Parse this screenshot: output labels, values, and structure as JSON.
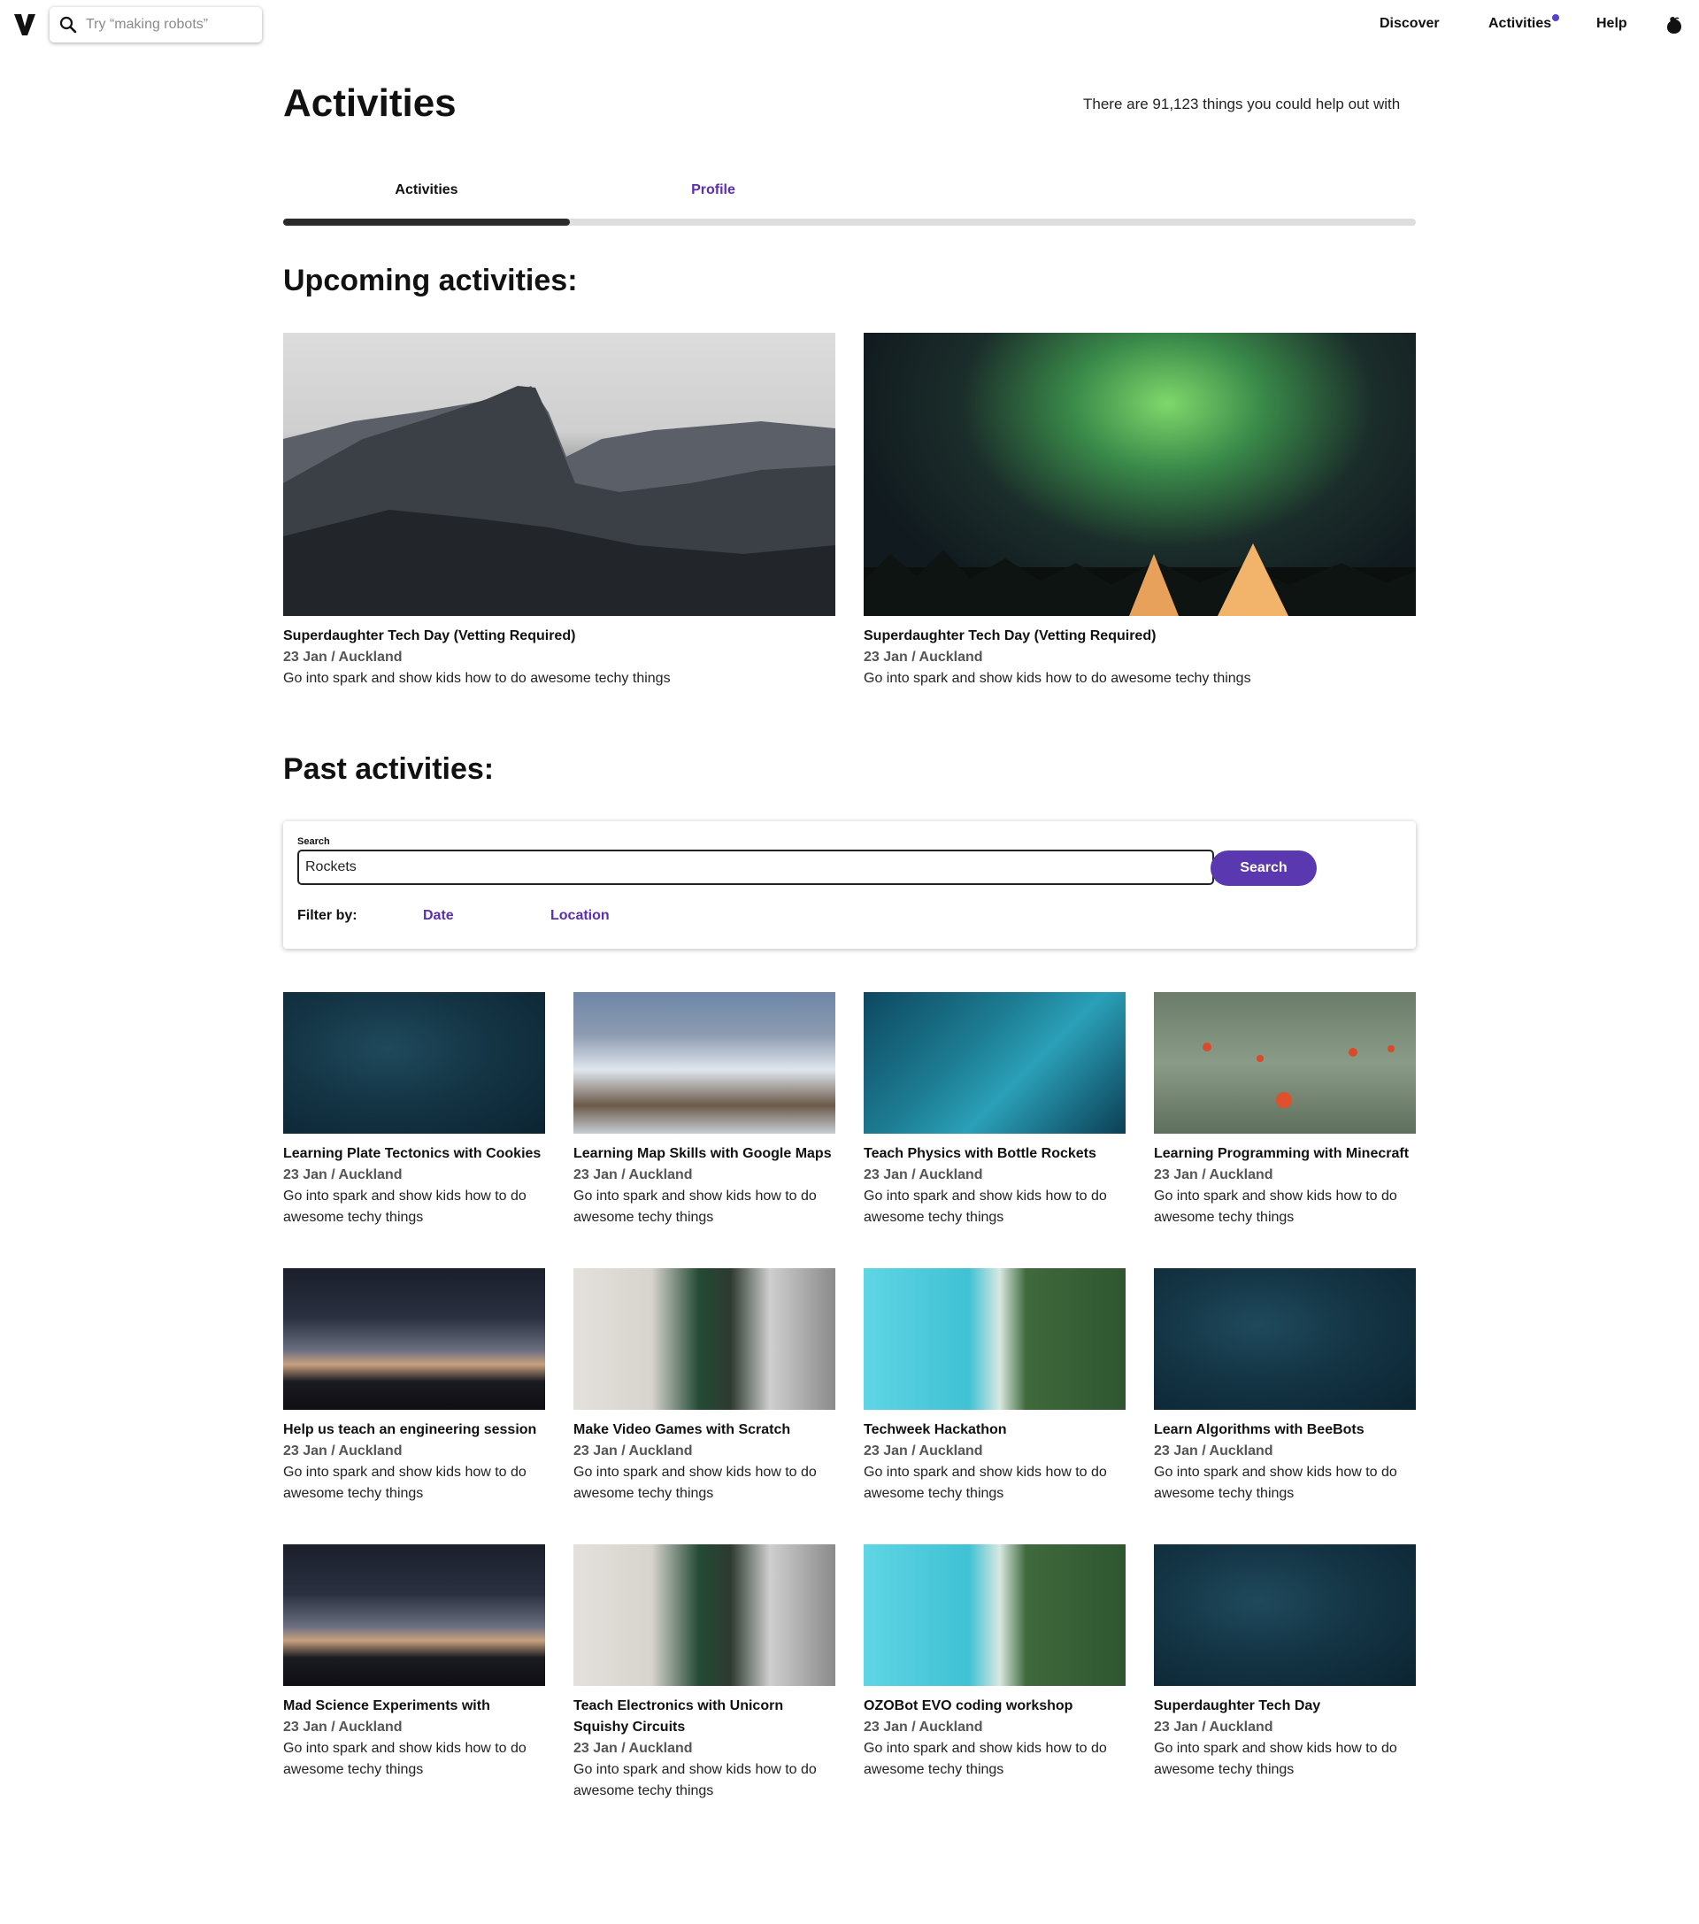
{
  "search": {
    "placeholder": "Try “making robots”"
  },
  "nav": {
    "items": [
      {
        "label": "Discover"
      },
      {
        "label": "Activities"
      },
      {
        "label": "Help"
      }
    ]
  },
  "header": {
    "title": "Activities",
    "count_text": "There are 91,123 things you could help out with"
  },
  "tabs": [
    {
      "label": "Activities",
      "active": true
    },
    {
      "label": "Profile",
      "active": false
    }
  ],
  "upcoming": {
    "heading": "Upcoming activities:",
    "items": [
      {
        "title": "Superdaughter Tech Day (Vetting Required)",
        "meta": "23 Jan / Auckland",
        "desc": "Go into spark and show kids how to do awesome techy things"
      },
      {
        "title": "Superdaughter Tech Day (Vetting Required)",
        "meta": "23 Jan / Auckland",
        "desc": "Go into spark and show kids how to do awesome techy things"
      }
    ]
  },
  "past": {
    "heading": "Past activities:",
    "search_label": "Search",
    "search_value": "Rockets",
    "search_button": "Search",
    "filter_label": "Filter by:",
    "filters": [
      "Date",
      "Location"
    ],
    "items": [
      {
        "title": "Learning Plate Tectonics with Cookies",
        "meta": "23 Jan / Auckland",
        "desc": "Go into spark and show kids how to do awesome techy things"
      },
      {
        "title": "Learning Map Skills with Google Maps",
        "meta": "23 Jan / Auckland",
        "desc": "Go into spark and show kids how to do awesome techy things"
      },
      {
        "title": "Teach Physics with Bottle Rockets",
        "meta": "23 Jan / Auckland",
        "desc": "Go into spark and show kids how to do awesome techy things"
      },
      {
        "title": "Learning Programming with Minecraft",
        "meta": "23 Jan / Auckland",
        "desc": "Go into spark and show kids how to do awesome techy things"
      },
      {
        "title": "Help us teach an engineering session",
        "meta": "23 Jan / Auckland",
        "desc": "Go into spark and show kids how to do awesome techy things"
      },
      {
        "title": "Make Video Games with Scratch",
        "meta": "23 Jan / Auckland",
        "desc": "Go into spark and show kids how to do awesome techy things"
      },
      {
        "title": "Techweek Hackathon",
        "meta": "23 Jan / Auckland",
        "desc": "Go into spark and show kids how to do awesome techy things"
      },
      {
        "title": "Learn Algorithms with BeeBots",
        "meta": "23 Jan / Auckland",
        "desc": "Go into spark and show kids how to do awesome techy things"
      },
      {
        "title": "Mad Science Experiments with",
        "meta": "23 Jan / Auckland",
        "desc": "Go into spark and show kids how to do awesome techy things"
      },
      {
        "title": "Teach Electronics with Unicorn Squishy Circuits",
        "meta": "23 Jan / Auckland",
        "desc": "Go into spark and show kids how to do awesome techy things"
      },
      {
        "title": "OZOBot EVO coding workshop",
        "meta": "23 Jan / Auckland",
        "desc": "Go into spark and show kids how to do awesome techy things"
      },
      {
        "title": "Superdaughter Tech Day",
        "meta": "23 Jan / Auckland",
        "desc": "Go into spark and show kids how to do awesome techy things"
      }
    ]
  },
  "colors": {
    "accent": "#5a38b0",
    "notification_dot": "#5b3fd0",
    "tab_indicator": "#2b2b2b"
  },
  "icons": [
    "logo-v-icon",
    "search-icon",
    "user-avatar-icon"
  ]
}
